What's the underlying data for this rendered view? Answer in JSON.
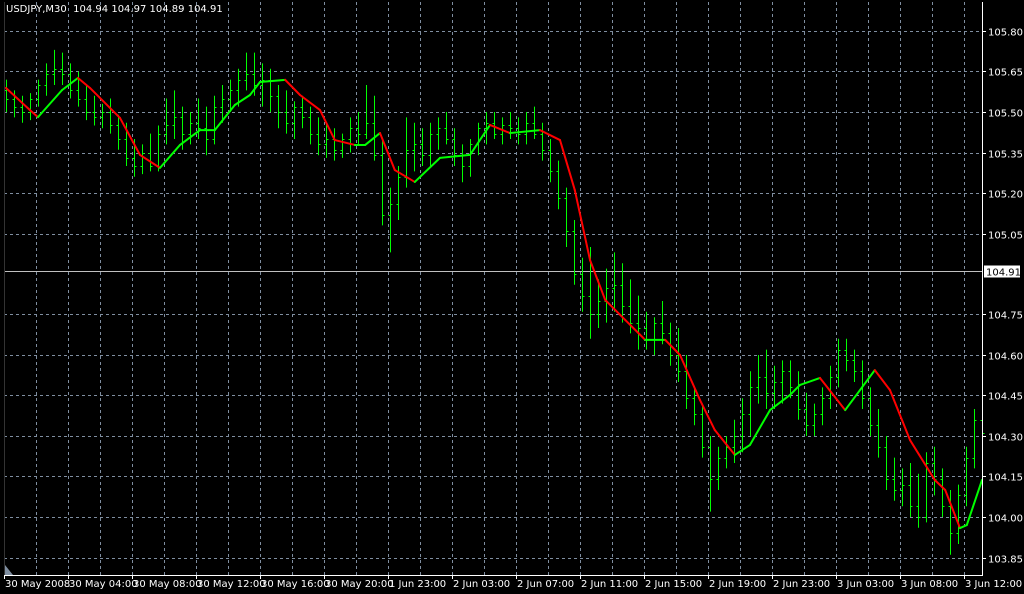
{
  "header": {
    "symbol": "USDJPY,M30",
    "open": "104.94",
    "high": "104.97",
    "low": "104.89",
    "close": "104.91"
  },
  "colors": {
    "background": "#000000",
    "grid": "#7f8ea0",
    "bars": "#00ff00",
    "ma_up": "#00ff00",
    "ma_down": "#ff0000",
    "axis": "#ffffff",
    "price_line": "#c0c0c0"
  },
  "chart_data": {
    "type": "line",
    "title": "USDJPY,M30",
    "ylim": [
      103.8,
      105.9
    ],
    "y_ticks": [
      "105.80",
      "105.65",
      "105.50",
      "105.35",
      "105.20",
      "105.05",
      "104.75",
      "104.60",
      "104.45",
      "104.30",
      "104.15",
      "104.00",
      "103.85"
    ],
    "current_price": "104.91",
    "x_ticks": [
      {
        "bar": 0,
        "label": "30 May 2008"
      },
      {
        "bar": 8,
        "label": "30 May 04:00"
      },
      {
        "bar": 16,
        "label": "30 May 08:00"
      },
      {
        "bar": 24,
        "label": "30 May 12:00"
      },
      {
        "bar": 32,
        "label": "30 May 16:00"
      },
      {
        "bar": 40,
        "label": "30 May 20:00"
      },
      {
        "bar": 48,
        "label": "1 Jun 23:00"
      },
      {
        "bar": 56,
        "label": "2 Jun 03:00"
      },
      {
        "bar": 64,
        "label": "2 Jun 07:00"
      },
      {
        "bar": 72,
        "label": "2 Jun 11:00"
      },
      {
        "bar": 80,
        "label": "2 Jun 15:00"
      },
      {
        "bar": 88,
        "label": "2 Jun 19:00"
      },
      {
        "bar": 96,
        "label": "2 Jun 23:00"
      },
      {
        "bar": 104,
        "label": "3 Jun 03:00"
      },
      {
        "bar": 112,
        "label": "3 Jun 08:00"
      },
      {
        "bar": 120,
        "label": "3 Jun 12:00"
      }
    ],
    "bars_ohlc": [
      [
        105.58,
        105.62,
        105.5,
        105.55
      ],
      [
        105.55,
        105.58,
        105.48,
        105.52
      ],
      [
        105.52,
        105.56,
        105.46,
        105.5
      ],
      [
        105.5,
        105.57,
        105.47,
        105.55
      ],
      [
        105.55,
        105.62,
        105.52,
        105.6
      ],
      [
        105.6,
        105.68,
        105.56,
        105.64
      ],
      [
        105.64,
        105.73,
        105.6,
        105.66
      ],
      [
        105.66,
        105.72,
        105.6,
        105.64
      ],
      [
        105.64,
        105.68,
        105.55,
        105.58
      ],
      [
        105.58,
        105.65,
        105.52,
        105.55
      ],
      [
        105.55,
        105.6,
        105.47,
        105.5
      ],
      [
        105.5,
        105.56,
        105.45,
        105.48
      ],
      [
        105.48,
        105.53,
        105.44,
        105.5
      ],
      [
        105.5,
        105.55,
        105.42,
        105.45
      ],
      [
        105.45,
        105.49,
        105.36,
        105.4
      ],
      [
        105.4,
        105.46,
        105.3,
        105.33
      ],
      [
        105.33,
        105.4,
        105.26,
        105.3
      ],
      [
        105.3,
        105.38,
        105.27,
        105.35
      ],
      [
        105.35,
        105.42,
        105.28,
        105.3
      ],
      [
        105.3,
        105.45,
        105.28,
        105.42
      ],
      [
        105.42,
        105.55,
        105.38,
        105.45
      ],
      [
        105.45,
        105.58,
        105.4,
        105.48
      ],
      [
        105.48,
        105.52,
        105.36,
        105.42
      ],
      [
        105.42,
        105.5,
        105.38,
        105.46
      ],
      [
        105.46,
        105.55,
        105.4,
        105.44
      ],
      [
        105.44,
        105.52,
        105.34,
        105.4
      ],
      [
        105.4,
        105.56,
        105.38,
        105.52
      ],
      [
        105.52,
        105.6,
        105.46,
        105.55
      ],
      [
        105.55,
        105.62,
        105.5,
        105.58
      ],
      [
        105.58,
        105.66,
        105.52,
        105.62
      ],
      [
        105.62,
        105.72,
        105.58,
        105.64
      ],
      [
        105.64,
        105.72,
        105.56,
        105.6
      ],
      [
        105.6,
        105.68,
        105.52,
        105.62
      ],
      [
        105.62,
        105.66,
        105.5,
        105.56
      ],
      [
        105.56,
        105.6,
        105.44,
        105.5
      ],
      [
        105.5,
        105.58,
        105.42,
        105.46
      ],
      [
        105.46,
        105.54,
        105.4,
        105.52
      ],
      [
        105.52,
        105.56,
        105.44,
        105.48
      ],
      [
        105.48,
        105.52,
        105.38,
        105.42
      ],
      [
        105.42,
        105.48,
        105.34,
        105.38
      ],
      [
        105.38,
        105.46,
        105.33,
        105.4
      ],
      [
        105.4,
        105.44,
        105.32,
        105.36
      ],
      [
        105.36,
        105.42,
        105.33,
        105.4
      ],
      [
        105.4,
        105.48,
        105.35,
        105.44
      ],
      [
        105.44,
        105.5,
        105.38,
        105.42
      ],
      [
        105.42,
        105.6,
        105.4,
        105.46
      ],
      [
        105.46,
        105.56,
        105.32,
        105.34
      ],
      [
        105.34,
        105.4,
        105.08,
        105.12
      ],
      [
        105.12,
        105.22,
        104.98,
        105.16
      ],
      [
        105.16,
        105.3,
        105.1,
        105.26
      ],
      [
        105.26,
        105.48,
        105.22,
        105.36
      ],
      [
        105.36,
        105.46,
        105.28,
        105.38
      ],
      [
        105.38,
        105.44,
        105.3,
        105.34
      ],
      [
        105.34,
        105.46,
        105.3,
        105.42
      ],
      [
        105.42,
        105.48,
        105.36,
        105.44
      ],
      [
        105.44,
        105.5,
        105.38,
        105.4
      ],
      [
        105.4,
        105.44,
        105.3,
        105.34
      ],
      [
        105.34,
        105.38,
        105.24,
        105.3
      ],
      [
        105.3,
        105.4,
        105.26,
        105.38
      ],
      [
        105.38,
        105.46,
        105.34,
        105.44
      ],
      [
        105.44,
        105.5,
        105.38,
        105.46
      ],
      [
        105.46,
        105.5,
        105.4,
        105.42
      ],
      [
        105.42,
        105.48,
        105.38,
        105.45
      ],
      [
        105.45,
        105.5,
        105.4,
        105.44
      ],
      [
        105.44,
        105.48,
        105.38,
        105.42
      ],
      [
        105.42,
        105.5,
        105.38,
        105.46
      ],
      [
        105.46,
        105.52,
        105.4,
        105.42
      ],
      [
        105.42,
        105.46,
        105.32,
        105.36
      ],
      [
        105.36,
        105.4,
        105.24,
        105.28
      ],
      [
        105.28,
        105.32,
        105.14,
        105.18
      ],
      [
        105.18,
        105.22,
        105.0,
        105.06
      ],
      [
        105.06,
        105.1,
        104.86,
        104.9
      ],
      [
        104.9,
        104.96,
        104.76,
        104.82
      ],
      [
        104.82,
        105.0,
        104.66,
        104.75
      ],
      [
        104.75,
        104.88,
        104.7,
        104.8
      ],
      [
        104.8,
        104.92,
        104.72,
        104.85
      ],
      [
        104.85,
        104.98,
        104.76,
        104.86
      ],
      [
        104.86,
        104.94,
        104.72,
        104.78
      ],
      [
        104.78,
        104.88,
        104.68,
        104.72
      ],
      [
        104.72,
        104.82,
        104.62,
        104.7
      ],
      [
        104.7,
        104.76,
        104.62,
        104.66
      ],
      [
        104.66,
        104.74,
        104.6,
        104.72
      ],
      [
        104.72,
        104.8,
        104.64,
        104.68
      ],
      [
        104.68,
        104.72,
        104.56,
        104.6
      ],
      [
        104.6,
        104.7,
        104.5,
        104.54
      ],
      [
        104.54,
        104.6,
        104.4,
        104.44
      ],
      [
        104.44,
        104.48,
        104.34,
        104.38
      ],
      [
        104.38,
        104.42,
        104.22,
        104.26
      ],
      [
        104.26,
        104.3,
        104.02,
        104.14
      ],
      [
        104.14,
        104.26,
        104.1,
        104.22
      ],
      [
        104.22,
        104.3,
        104.18,
        104.26
      ],
      [
        104.26,
        104.36,
        104.2,
        104.3
      ],
      [
        104.3,
        104.44,
        104.24,
        104.38
      ],
      [
        104.38,
        104.54,
        104.3,
        104.48
      ],
      [
        104.48,
        104.6,
        104.42,
        104.52
      ],
      [
        104.52,
        104.62,
        104.4,
        104.46
      ],
      [
        104.46,
        104.56,
        104.4,
        104.5
      ],
      [
        104.5,
        104.58,
        104.42,
        104.54
      ],
      [
        104.54,
        104.58,
        104.44,
        104.48
      ],
      [
        104.48,
        104.54,
        104.36,
        104.4
      ],
      [
        104.4,
        104.46,
        104.3,
        104.34
      ],
      [
        104.34,
        104.42,
        104.3,
        104.38
      ],
      [
        104.38,
        104.48,
        104.34,
        104.44
      ],
      [
        104.44,
        104.56,
        104.4,
        104.52
      ],
      [
        104.52,
        104.66,
        104.48,
        104.62
      ],
      [
        104.62,
        104.66,
        104.54,
        104.58
      ],
      [
        104.58,
        104.62,
        104.5,
        104.54
      ],
      [
        104.54,
        104.58,
        104.4,
        104.44
      ],
      [
        104.44,
        104.48,
        104.3,
        104.34
      ],
      [
        104.34,
        104.4,
        104.22,
        104.26
      ],
      [
        104.26,
        104.3,
        104.1,
        104.14
      ],
      [
        104.14,
        104.22,
        104.06,
        104.1
      ],
      [
        104.1,
        104.18,
        104.04,
        104.12
      ],
      [
        104.12,
        104.2,
        104.0,
        104.04
      ],
      [
        104.04,
        104.16,
        103.96,
        104.0
      ],
      [
        104.0,
        104.24,
        103.98,
        104.2
      ],
      [
        104.2,
        104.26,
        104.08,
        104.14
      ],
      [
        104.14,
        104.18,
        104.0,
        104.04
      ],
      [
        104.04,
        104.1,
        103.86,
        103.94
      ],
      [
        103.94,
        104.12,
        103.9,
        104.08
      ],
      [
        104.08,
        104.26,
        104.04,
        104.22
      ],
      [
        104.22,
        104.4,
        104.18,
        104.36
      ],
      [
        104.36,
        104.4,
        104.28,
        104.31
      ]
    ],
    "moving_average": [
      [
        0,
        105.589
      ],
      [
        3,
        105.507
      ],
      [
        4,
        105.481
      ],
      [
        7,
        105.581
      ],
      [
        9,
        105.626
      ],
      [
        10.5,
        105.589
      ],
      [
        14.25,
        105.478
      ],
      [
        16.75,
        105.341
      ],
      [
        19.25,
        105.293
      ],
      [
        21.75,
        105.378
      ],
      [
        24.25,
        105.433
      ],
      [
        26.1,
        105.433
      ],
      [
        28.6,
        105.526
      ],
      [
        30.5,
        105.563
      ],
      [
        31.75,
        105.611
      ],
      [
        34.9,
        105.619
      ],
      [
        36.75,
        105.563
      ],
      [
        39.25,
        105.507
      ],
      [
        41.1,
        105.396
      ],
      [
        43.6,
        105.378
      ],
      [
        44.9,
        105.378
      ],
      [
        46.75,
        105.422
      ],
      [
        48.6,
        105.285
      ],
      [
        51.1,
        105.241
      ],
      [
        54.25,
        105.33
      ],
      [
        58,
        105.341
      ],
      [
        60.5,
        105.452
      ],
      [
        63,
        105.422
      ],
      [
        66.75,
        105.433
      ],
      [
        69.25,
        105.396
      ],
      [
        71.1,
        105.211
      ],
      [
        73,
        104.952
      ],
      [
        74.9,
        104.804
      ],
      [
        77.4,
        104.73
      ],
      [
        79.9,
        104.656
      ],
      [
        82.4,
        104.656
      ],
      [
        84.25,
        104.6
      ],
      [
        86.75,
        104.433
      ],
      [
        88.6,
        104.322
      ],
      [
        91.1,
        104.23
      ],
      [
        93,
        104.267
      ],
      [
        95.5,
        104.396
      ],
      [
        98,
        104.452
      ],
      [
        99.25,
        104.489
      ],
      [
        101.75,
        104.515
      ],
      [
        104.9,
        104.396
      ],
      [
        108.6,
        104.544
      ],
      [
        110.5,
        104.47
      ],
      [
        113,
        104.285
      ],
      [
        116.1,
        104.137
      ],
      [
        117.4,
        104.1
      ],
      [
        119.25,
        103.959
      ],
      [
        120.1,
        103.97
      ],
      [
        122,
        104.137
      ]
    ]
  }
}
